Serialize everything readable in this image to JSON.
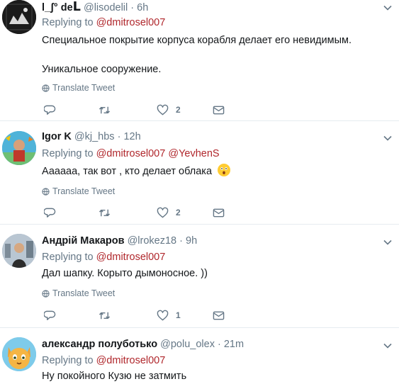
{
  "tweets": [
    {
      "name": "l_ʃ° de",
      "logo_mark": "ᒪ",
      "handle": "@lisodelil",
      "time": "6h",
      "replying_label": "Replying to",
      "mentions": [
        "@dmitrosel007"
      ],
      "text_lines": [
        "Специальное покрытие корпуса корабля делает его невидимым.",
        "Уникальное сооружение."
      ],
      "translate": "Translate Tweet",
      "likes": "2"
    },
    {
      "name": "Igor K",
      "handle": "@kj_hbs",
      "time": "12h",
      "replying_label": "Replying to",
      "mentions": [
        "@dmitrosel007",
        "@YevhenS"
      ],
      "text_lines": [
        "Аааааа, так вот , кто делает облака"
      ],
      "emoji": "astonished-face",
      "translate": "Translate Tweet",
      "likes": "2"
    },
    {
      "name": "Андрій Макаров",
      "handle": "@lrokez18",
      "time": "9h",
      "replying_label": "Replying to",
      "mentions": [
        "@dmitrosel007"
      ],
      "text_lines": [
        "Дал шапку. Корыто дымоносное. ))"
      ],
      "translate": "Translate Tweet",
      "likes": "1"
    },
    {
      "name": "александр полуботько",
      "handle": "@polu_olex",
      "time": "21m",
      "replying_label": "Replying to",
      "mentions": [
        "@dmitrosel007"
      ],
      "text_lines": [
        "Ну покойного Кузю не затмить"
      ]
    }
  ],
  "separator": "·",
  "icons": {
    "reply": "reply-icon",
    "retweet": "retweet-icon",
    "like": "heart-icon",
    "dm": "envelope-icon",
    "translate": "globe-icon",
    "caret": "chevron-down-icon"
  },
  "colors": {
    "mention": "#b0272c",
    "muted": "#657786",
    "text": "#14171a",
    "divider": "#e6ecf0"
  }
}
